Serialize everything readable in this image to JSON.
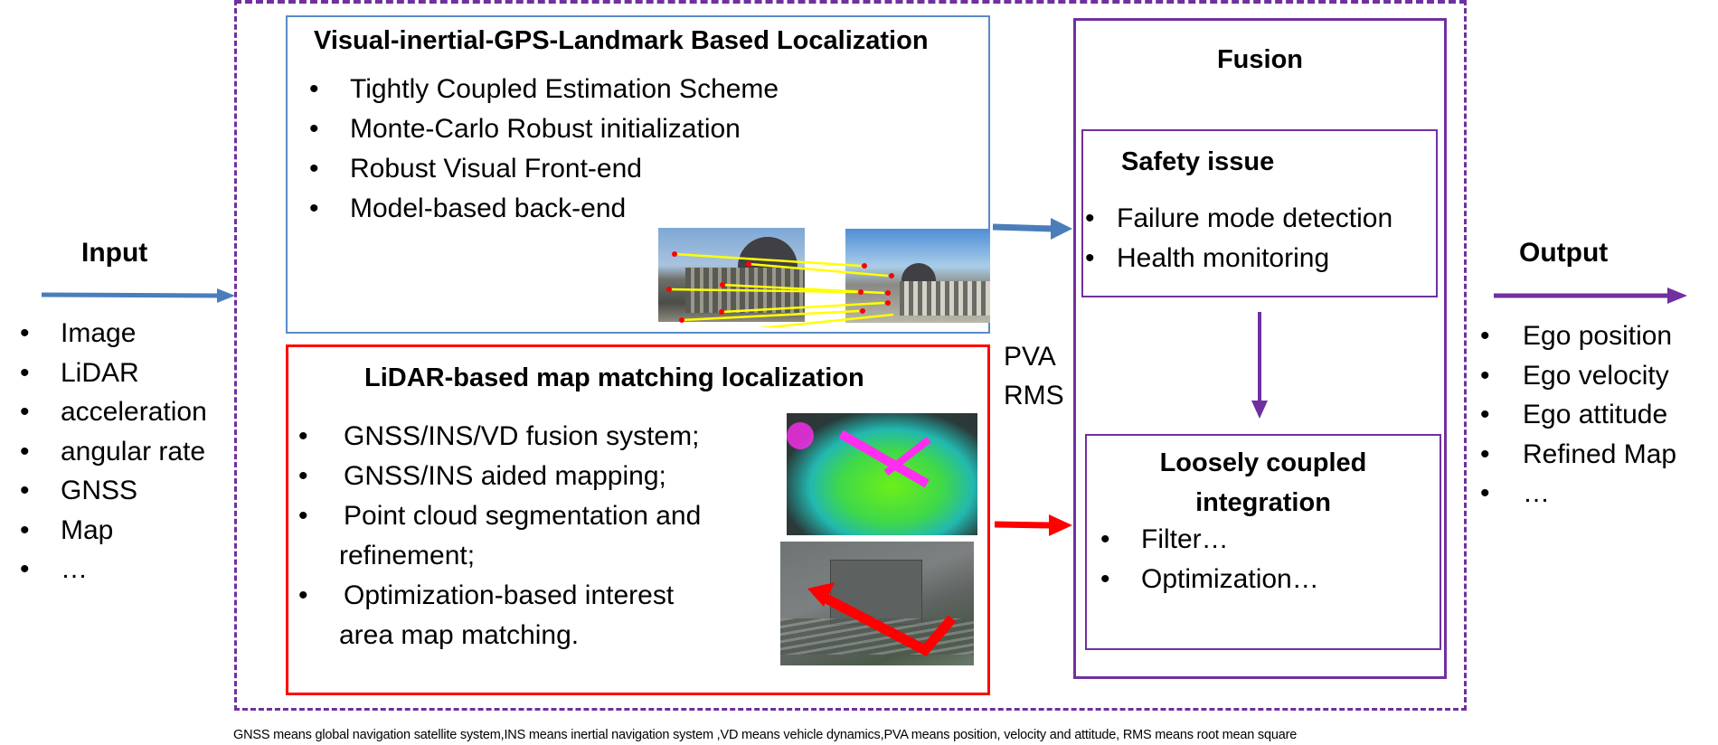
{
  "input": {
    "title": "Input",
    "items": [
      "Image",
      "LiDAR",
      "acceleration",
      "angular rate",
      "GNSS",
      "Map",
      "…"
    ]
  },
  "visual_box": {
    "title": "Visual-inertial-GPS-Landmark Based Localization",
    "items": [
      "Tightly Coupled Estimation Scheme",
      "Monte-Carlo Robust initialization",
      "Robust Visual Front-end",
      "Model-based back-end"
    ],
    "image_left": "building-feature-matching-image-1",
    "image_right": "building-feature-matching-image-2"
  },
  "lidar_box": {
    "title": "LiDAR-based map matching localization",
    "items": [
      "GNSS/INS/VD fusion system;",
      "GNSS/INS aided mapping;",
      "Point cloud segmentation and",
      "refinement;",
      "Optimization-based interest",
      "area map matching."
    ],
    "bullets": [
      true,
      true,
      true,
      false,
      true,
      false
    ],
    "image_top": "lidar-point-cloud-image",
    "image_bottom": "aerial-map-route-image"
  },
  "pva_rms": {
    "line1": "PVA",
    "line2": "RMS"
  },
  "fusion": {
    "title": "Fusion",
    "safety": {
      "title": "Safety issue",
      "items": [
        "Failure mode detection",
        "Health monitoring"
      ]
    },
    "loose": {
      "title_line1": "Loosely coupled",
      "title_line2": "integration",
      "items": [
        "Filter…",
        "Optimization…"
      ]
    }
  },
  "output": {
    "title": "Output",
    "items": [
      "Ego position",
      "Ego velocity",
      "Ego attitude",
      "Refined Map",
      "…"
    ]
  },
  "caption": "GNSS means global navigation satellite system,INS means inertial navigation system ,VD means vehicle dynamics,PVA means position, velocity and attitude, RMS means root mean square",
  "colors": {
    "blue": "#5a8ac6",
    "red": "#ff0000",
    "purple": "#7030a0",
    "arrow_blue": "#4a7ebb"
  }
}
